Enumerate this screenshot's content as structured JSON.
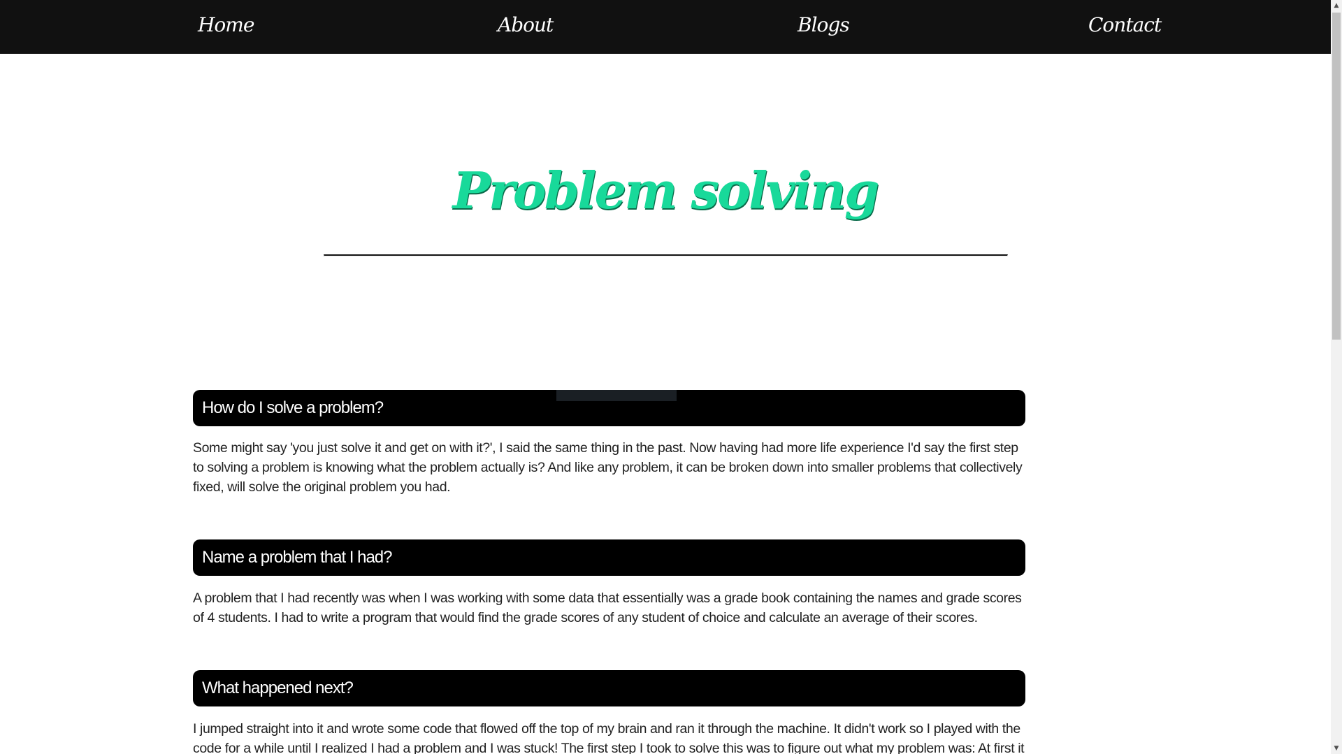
{
  "nav": {
    "home": "Home",
    "about": "About",
    "blogs": "Blogs",
    "contact": "Contact"
  },
  "page": {
    "title": "Problem solving"
  },
  "sections": [
    {
      "heading": "How do I solve a problem?",
      "body": "Some might say 'you just solve it and get on with it?', I said the same thing in the past. Now having had more life experience I'd say the first step to solving a problem is knowing what the problem actually is? And like any problem, it can be broken down into smaller problems that collectively fixed, will solve the original problem you had."
    },
    {
      "heading": "Name a problem that I had?",
      "body": "A problem that I had recently was when I was working with some data that essentially was a grade book containing the names and grade scores of 4 students. I had to write a program that would find the grade scores of any student of choice and calculate an average of their scores."
    },
    {
      "heading": "What happened next?",
      "body": "I jumped straight into it and wrote some code that flowed off the top of my brain and ran it through the machine. It didn't work so I played with the code for a while until I realized I had a problem and I was stuck! The first step I took to solve this was to figure out what my problem was: At first it was that I wasn't able"
    }
  ],
  "colors": {
    "nav_background": "#111111",
    "title_color": "#18d99a",
    "section_header_background": "#000000",
    "body_text": "#222222"
  },
  "icons": {
    "scroll_up": "scroll-up-arrow-icon",
    "scroll_down": "scroll-down-arrow-icon"
  }
}
